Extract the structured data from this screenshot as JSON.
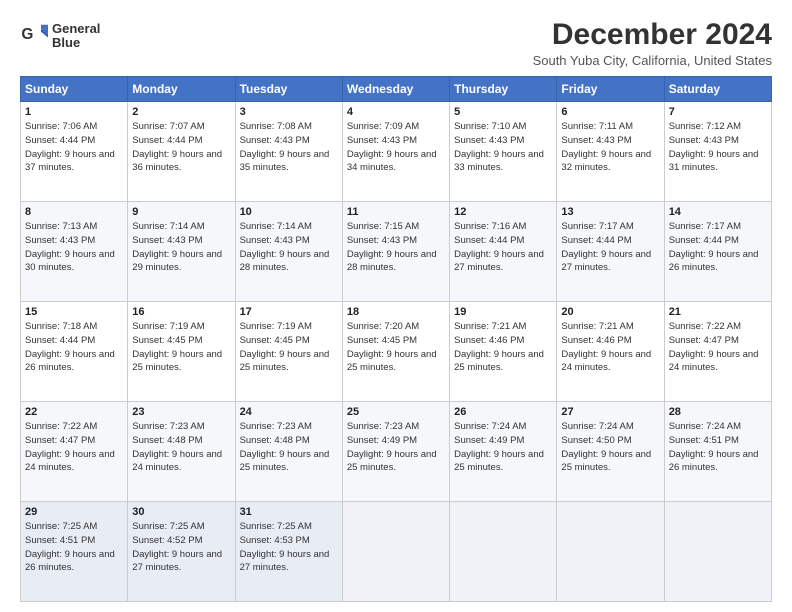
{
  "logo": {
    "line1": "General",
    "line2": "Blue"
  },
  "title": "December 2024",
  "subtitle": "South Yuba City, California, United States",
  "days_of_week": [
    "Sunday",
    "Monday",
    "Tuesday",
    "Wednesday",
    "Thursday",
    "Friday",
    "Saturday"
  ],
  "weeks": [
    [
      {
        "day": "1",
        "sunrise": "Sunrise: 7:06 AM",
        "sunset": "Sunset: 4:44 PM",
        "daylight": "Daylight: 9 hours and 37 minutes."
      },
      {
        "day": "2",
        "sunrise": "Sunrise: 7:07 AM",
        "sunset": "Sunset: 4:44 PM",
        "daylight": "Daylight: 9 hours and 36 minutes."
      },
      {
        "day": "3",
        "sunrise": "Sunrise: 7:08 AM",
        "sunset": "Sunset: 4:43 PM",
        "daylight": "Daylight: 9 hours and 35 minutes."
      },
      {
        "day": "4",
        "sunrise": "Sunrise: 7:09 AM",
        "sunset": "Sunset: 4:43 PM",
        "daylight": "Daylight: 9 hours and 34 minutes."
      },
      {
        "day": "5",
        "sunrise": "Sunrise: 7:10 AM",
        "sunset": "Sunset: 4:43 PM",
        "daylight": "Daylight: 9 hours and 33 minutes."
      },
      {
        "day": "6",
        "sunrise": "Sunrise: 7:11 AM",
        "sunset": "Sunset: 4:43 PM",
        "daylight": "Daylight: 9 hours and 32 minutes."
      },
      {
        "day": "7",
        "sunrise": "Sunrise: 7:12 AM",
        "sunset": "Sunset: 4:43 PM",
        "daylight": "Daylight: 9 hours and 31 minutes."
      }
    ],
    [
      {
        "day": "8",
        "sunrise": "Sunrise: 7:13 AM",
        "sunset": "Sunset: 4:43 PM",
        "daylight": "Daylight: 9 hours and 30 minutes."
      },
      {
        "day": "9",
        "sunrise": "Sunrise: 7:14 AM",
        "sunset": "Sunset: 4:43 PM",
        "daylight": "Daylight: 9 hours and 29 minutes."
      },
      {
        "day": "10",
        "sunrise": "Sunrise: 7:14 AM",
        "sunset": "Sunset: 4:43 PM",
        "daylight": "Daylight: 9 hours and 28 minutes."
      },
      {
        "day": "11",
        "sunrise": "Sunrise: 7:15 AM",
        "sunset": "Sunset: 4:43 PM",
        "daylight": "Daylight: 9 hours and 28 minutes."
      },
      {
        "day": "12",
        "sunrise": "Sunrise: 7:16 AM",
        "sunset": "Sunset: 4:44 PM",
        "daylight": "Daylight: 9 hours and 27 minutes."
      },
      {
        "day": "13",
        "sunrise": "Sunrise: 7:17 AM",
        "sunset": "Sunset: 4:44 PM",
        "daylight": "Daylight: 9 hours and 27 minutes."
      },
      {
        "day": "14",
        "sunrise": "Sunrise: 7:17 AM",
        "sunset": "Sunset: 4:44 PM",
        "daylight": "Daylight: 9 hours and 26 minutes."
      }
    ],
    [
      {
        "day": "15",
        "sunrise": "Sunrise: 7:18 AM",
        "sunset": "Sunset: 4:44 PM",
        "daylight": "Daylight: 9 hours and 26 minutes."
      },
      {
        "day": "16",
        "sunrise": "Sunrise: 7:19 AM",
        "sunset": "Sunset: 4:45 PM",
        "daylight": "Daylight: 9 hours and 25 minutes."
      },
      {
        "day": "17",
        "sunrise": "Sunrise: 7:19 AM",
        "sunset": "Sunset: 4:45 PM",
        "daylight": "Daylight: 9 hours and 25 minutes."
      },
      {
        "day": "18",
        "sunrise": "Sunrise: 7:20 AM",
        "sunset": "Sunset: 4:45 PM",
        "daylight": "Daylight: 9 hours and 25 minutes."
      },
      {
        "day": "19",
        "sunrise": "Sunrise: 7:21 AM",
        "sunset": "Sunset: 4:46 PM",
        "daylight": "Daylight: 9 hours and 25 minutes."
      },
      {
        "day": "20",
        "sunrise": "Sunrise: 7:21 AM",
        "sunset": "Sunset: 4:46 PM",
        "daylight": "Daylight: 9 hours and 24 minutes."
      },
      {
        "day": "21",
        "sunrise": "Sunrise: 7:22 AM",
        "sunset": "Sunset: 4:47 PM",
        "daylight": "Daylight: 9 hours and 24 minutes."
      }
    ],
    [
      {
        "day": "22",
        "sunrise": "Sunrise: 7:22 AM",
        "sunset": "Sunset: 4:47 PM",
        "daylight": "Daylight: 9 hours and 24 minutes."
      },
      {
        "day": "23",
        "sunrise": "Sunrise: 7:23 AM",
        "sunset": "Sunset: 4:48 PM",
        "daylight": "Daylight: 9 hours and 24 minutes."
      },
      {
        "day": "24",
        "sunrise": "Sunrise: 7:23 AM",
        "sunset": "Sunset: 4:48 PM",
        "daylight": "Daylight: 9 hours and 25 minutes."
      },
      {
        "day": "25",
        "sunrise": "Sunrise: 7:23 AM",
        "sunset": "Sunset: 4:49 PM",
        "daylight": "Daylight: 9 hours and 25 minutes."
      },
      {
        "day": "26",
        "sunrise": "Sunrise: 7:24 AM",
        "sunset": "Sunset: 4:49 PM",
        "daylight": "Daylight: 9 hours and 25 minutes."
      },
      {
        "day": "27",
        "sunrise": "Sunrise: 7:24 AM",
        "sunset": "Sunset: 4:50 PM",
        "daylight": "Daylight: 9 hours and 25 minutes."
      },
      {
        "day": "28",
        "sunrise": "Sunrise: 7:24 AM",
        "sunset": "Sunset: 4:51 PM",
        "daylight": "Daylight: 9 hours and 26 minutes."
      }
    ],
    [
      {
        "day": "29",
        "sunrise": "Sunrise: 7:25 AM",
        "sunset": "Sunset: 4:51 PM",
        "daylight": "Daylight: 9 hours and 26 minutes."
      },
      {
        "day": "30",
        "sunrise": "Sunrise: 7:25 AM",
        "sunset": "Sunset: 4:52 PM",
        "daylight": "Daylight: 9 hours and 27 minutes."
      },
      {
        "day": "31",
        "sunrise": "Sunrise: 7:25 AM",
        "sunset": "Sunset: 4:53 PM",
        "daylight": "Daylight: 9 hours and 27 minutes."
      },
      null,
      null,
      null,
      null
    ]
  ]
}
